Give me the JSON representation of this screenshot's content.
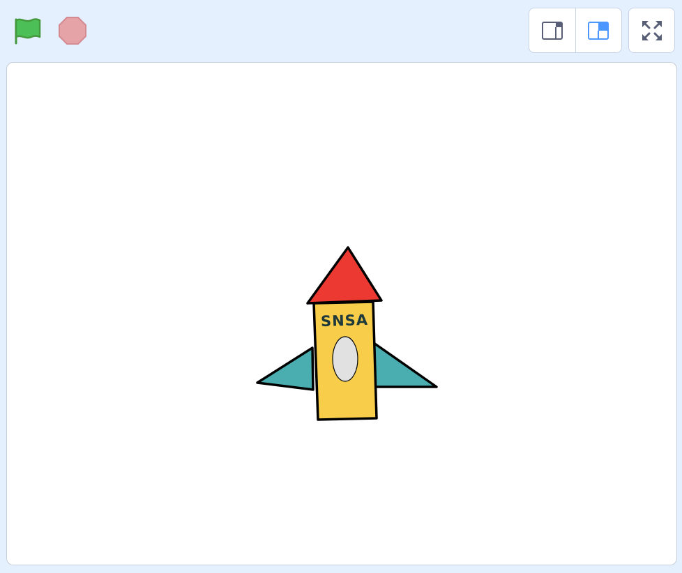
{
  "toolbar": {
    "green_flag_icon": "green-flag-icon",
    "stop_icon": "stop-sign-icon",
    "small_stage_icon": "small-stage-layout-icon",
    "normal_stage_icon": "normal-stage-layout-icon",
    "fullscreen_icon": "fullscreen-icon"
  },
  "stage": {
    "sprite": {
      "name_text": "SNSA"
    }
  },
  "colors": {
    "background": "#e5f0ff",
    "flag_green": "#4caf50",
    "stop_red": "#e5a3a8",
    "active_blue": "#4c97ff",
    "rocket_nose": "#ec3a32",
    "rocket_body": "#f8cd4a",
    "rocket_fins": "#4aaeb0",
    "rocket_window": "#e1e1e1"
  }
}
